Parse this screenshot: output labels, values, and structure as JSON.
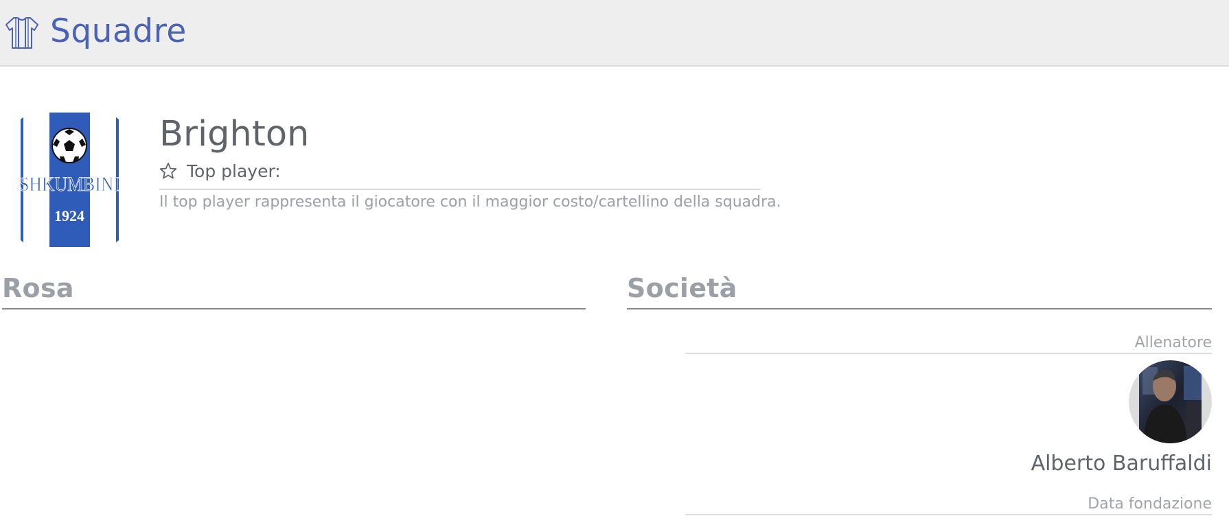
{
  "header": {
    "title": "Squadre",
    "icon": "jersey-icon",
    "accent_color": "#4a62b4",
    "background_color": "#eeeeee"
  },
  "team": {
    "name": "Brighton",
    "logo": {
      "text_name": "SHKUMBINI",
      "text_year": "1924",
      "colors": [
        "#2f5cb8",
        "#ffffff"
      ]
    },
    "top_player_label": "Top player:",
    "top_player_icon": "star-outline-icon",
    "top_player_note": "Il top player rappresenta il giocatore con il maggior costo/cartellino della squadra."
  },
  "sections": {
    "roster_title": "Rosa",
    "club_title": "Società"
  },
  "club": {
    "coach_label": "Allenatore",
    "coach_name": "Alberto Baruffaldi",
    "founded_label": "Data fondazione"
  }
}
